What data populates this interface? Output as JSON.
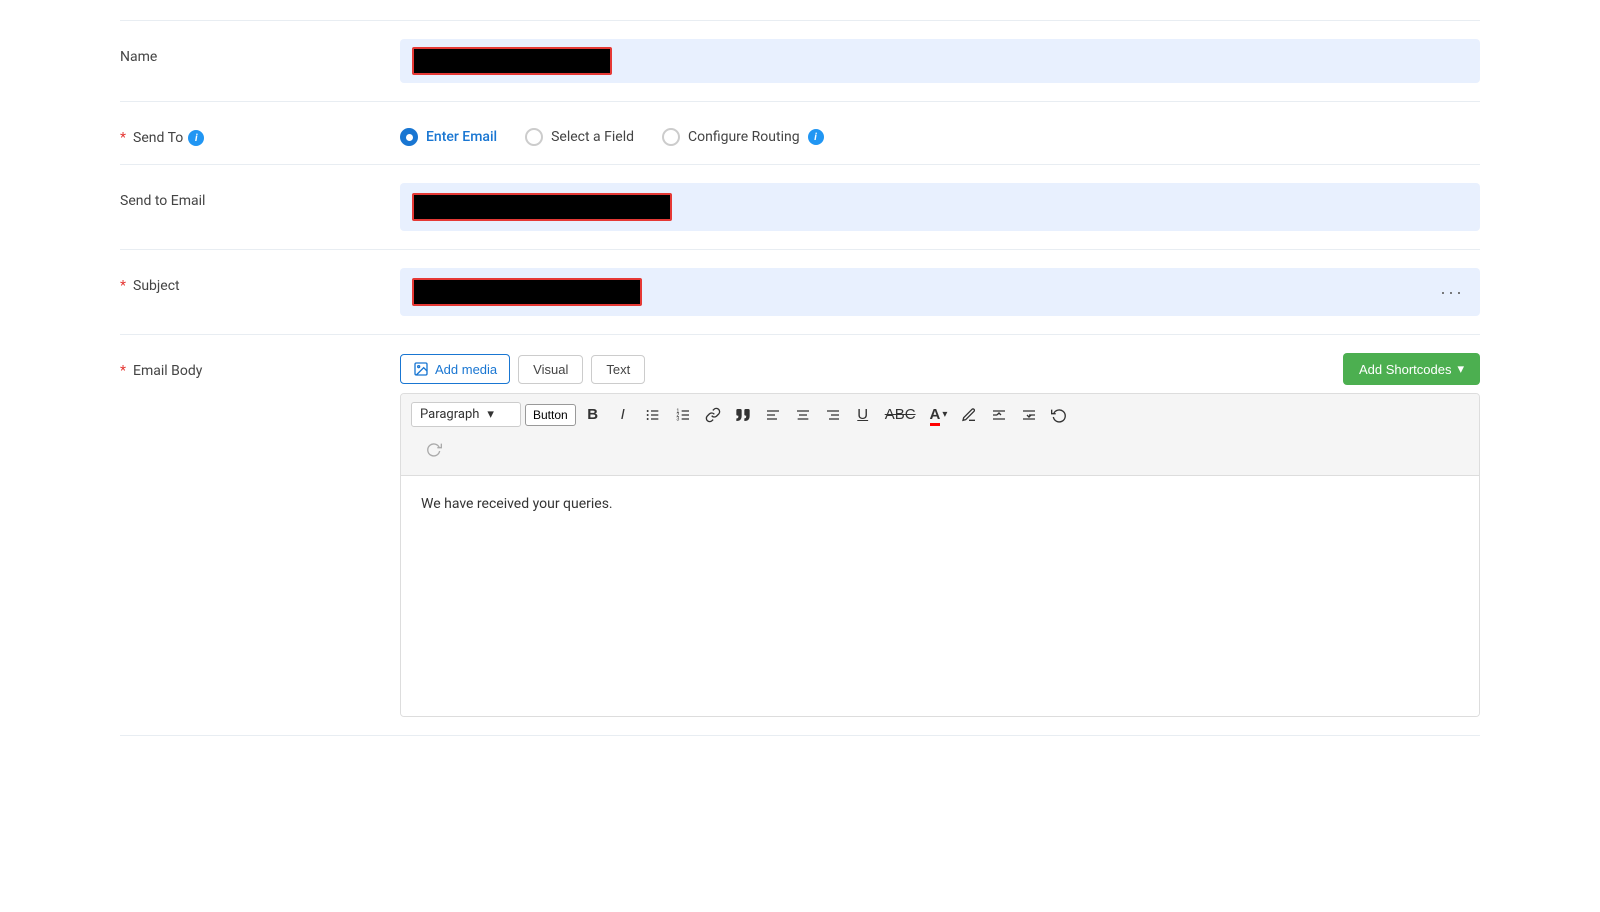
{
  "form": {
    "name_label": "Name",
    "send_to_label": "Send To",
    "send_to_email_label": "Send to Email",
    "subject_label": "Subject",
    "email_body_label": "Email Body"
  },
  "send_to_options": [
    {
      "id": "enter_email",
      "label": "Enter Email",
      "selected": true
    },
    {
      "id": "select_field",
      "label": "Select a Field",
      "selected": false
    },
    {
      "id": "configure_routing",
      "label": "Configure Routing",
      "selected": false
    }
  ],
  "toolbar": {
    "add_media_label": "Add media",
    "visual_tab": "Visual",
    "text_tab": "Text",
    "add_shortcodes_label": "Add Shortcodes",
    "paragraph_select": "Paragraph",
    "button_label": "Button",
    "bold_title": "Bold",
    "italic_title": "Italic",
    "ul_title": "Unordered List",
    "ol_title": "Ordered List",
    "link_title": "Link",
    "blockquote_title": "Blockquote",
    "align_left_title": "Align Left",
    "align_center_title": "Align Center",
    "align_right_title": "Align Right",
    "underline_title": "Underline",
    "strikethrough_title": "Strikethrough",
    "text_color_title": "Text Color",
    "pencil_title": "Pencil",
    "indent_title": "Indent",
    "outdent_title": "Outdent",
    "undo_title": "Undo",
    "redo_title": "Redo"
  },
  "editor": {
    "body_text": "We have received your queries."
  },
  "dots_label": "···"
}
